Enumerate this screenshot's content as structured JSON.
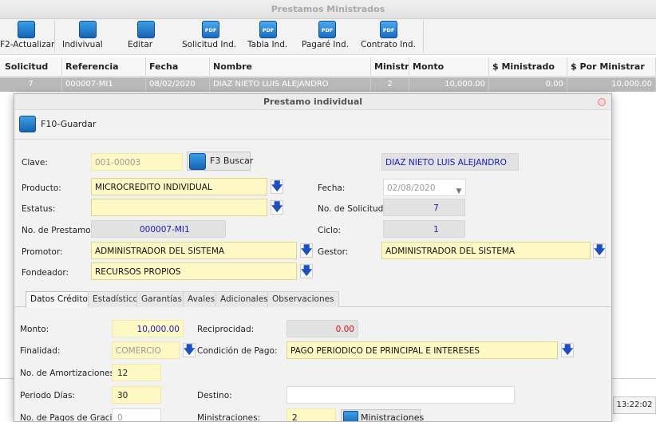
{
  "window": {
    "title": "Prestamos Ministrados"
  },
  "toolbar": {
    "buttons": [
      {
        "label": "F2-Actualizar",
        "icon": "refresh-icon"
      },
      {
        "label": "Indivivual",
        "icon": "document-icon"
      },
      {
        "label": "Editar",
        "icon": "edit-icon"
      },
      {
        "label": "Solicitud Ind.",
        "icon": "pdf-icon"
      },
      {
        "label": "Tabla Ind.",
        "icon": "pdf-icon"
      },
      {
        "label": "Pagaré Ind.",
        "icon": "pdf-icon"
      },
      {
        "label": "Contrato Ind.",
        "icon": "pdf-icon"
      }
    ],
    "pdf_badge": "PDF"
  },
  "grid": {
    "columns": [
      "Solicitud",
      "Referencia",
      "Fecha",
      "Nombre",
      "Ministr.",
      "Monto",
      "$ Ministrado",
      "$ Por Ministrar"
    ],
    "rows": [
      {
        "solicitud": "7",
        "referencia": "000007-MI1",
        "fecha": "08/02/2020",
        "nombre": "DIAZ NIETO LUIS ALEJANDRO",
        "ministr": "2",
        "monto": "10,000.00",
        "ministrado": "0.00",
        "por_ministrar": "10,000.00"
      }
    ]
  },
  "clock": "13:22:02",
  "dialog": {
    "title": "Prestamo individual",
    "save_label": "F10-Guardar",
    "clave_label": "Clave:",
    "clave_value": "001-00003",
    "search_label": "F3 Buscar",
    "client_name": "DIAZ NIETO LUIS ALEJANDRO",
    "producto_label": "Producto:",
    "producto_value": "MICROCREDITO INDIVIDUAL",
    "fecha_label": "Fecha:",
    "fecha_value": "02/08/2020",
    "estatus_label": "Estatus:",
    "estatus_value": "",
    "solicitud_label": "No. de Solicitud:",
    "solicitud_value": "7",
    "prestamo_label": "No. de Prestamo:",
    "prestamo_value": "000007-MI1",
    "ciclo_label": "Ciclo:",
    "ciclo_value": "1",
    "promotor_label": "Promotor:",
    "promotor_value": "ADMINISTRADOR DEL SISTEMA",
    "gestor_label": "Gestor:",
    "gestor_value": "ADMINISTRADOR DEL SISTEMA",
    "fondeador_label": "Fondeador:",
    "fondeador_value": "RECURSOS PROPIOS",
    "arrow_glyph": "🡇",
    "tabs": [
      "Datos Crédito",
      "Estadísticos",
      "Garantías",
      "Avales",
      "Adicionales",
      "Observaciones"
    ],
    "active_tab": "Datos Crédito",
    "credito": {
      "monto_label": "Monto:",
      "monto_value": "10,000.00",
      "reciprocidad_label": "Reciprocidad:",
      "reciprocidad_value": "0.00",
      "finalidad_label": "Finalidad:",
      "finalidad_value": "COMERCIO",
      "condicion_label": "Condición de Pago:",
      "condicion_value": "PAGO PERIODICO DE PRINCIPAL E INTERESES",
      "amortizaciones_label": "No. de Amortizaciones:",
      "amortizaciones_value": "12",
      "periodo_label": "Periodo Días:",
      "periodo_value": "30",
      "destino_label": "Destino:",
      "destino_value": "",
      "gracia_label": "No. de Pagos de Gracia:",
      "gracia_value": "0",
      "ministraciones_label": "Ministraciones:",
      "ministraciones_value": "2",
      "ministraciones_button": "Ministraciones"
    }
  },
  "colors": {
    "accent_blue": "#1d4fc4",
    "field_yellow": "#fdf8c4",
    "row_selected": "#b9b9b9"
  }
}
